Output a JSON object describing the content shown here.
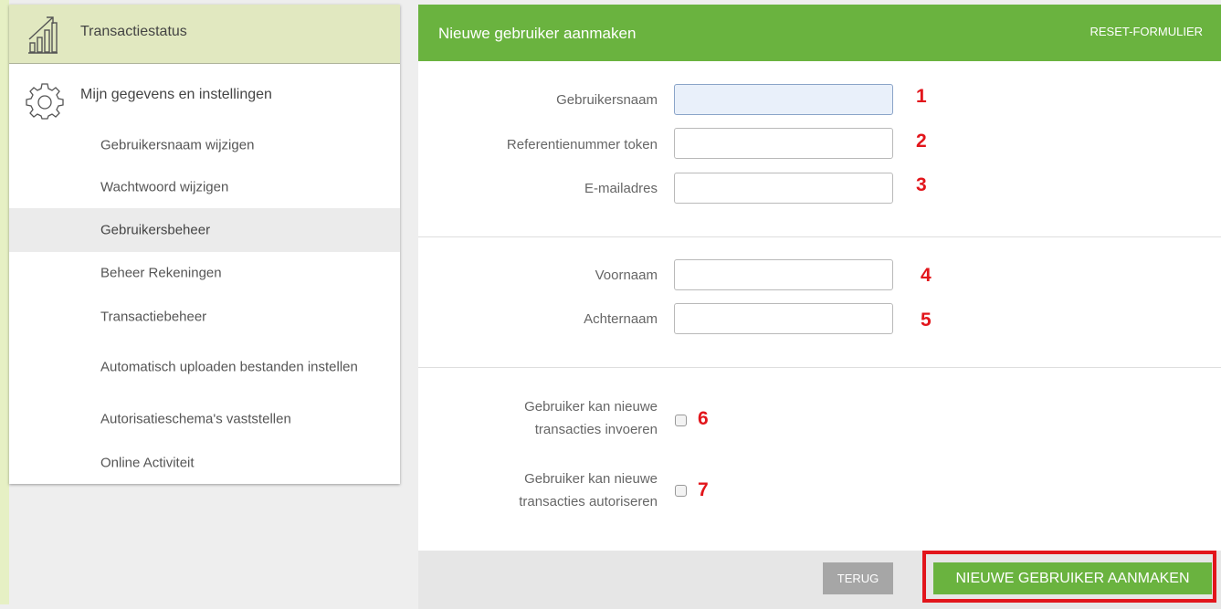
{
  "sidebar": {
    "header_label": "Transactiestatus",
    "section_label": "Mijn gegevens en instellingen",
    "items": [
      {
        "label": "Gebruikersnaam wijzigen"
      },
      {
        "label": "Wachtwoord wijzigen"
      },
      {
        "label": "Gebruikersbeheer",
        "active": true
      },
      {
        "label": "Beheer Rekeningen"
      },
      {
        "label": "Transactiebeheer"
      },
      {
        "label": "Automatisch uploaden bestanden instellen"
      },
      {
        "label": "Autorisatieschema's vaststellen"
      },
      {
        "label": "Online Activiteit"
      }
    ]
  },
  "form": {
    "title": "Nieuwe gebruiker aanmaken",
    "reset_label": "RESET-FORMULIER",
    "fields": [
      {
        "label": "Gebruikersnaam",
        "value": "",
        "marker": "1"
      },
      {
        "label": "Referentienummer token",
        "value": "",
        "marker": "2"
      },
      {
        "label": "E-mailadres",
        "value": "",
        "marker": "3"
      },
      {
        "label": "Voornaam",
        "value": "",
        "marker": "4"
      },
      {
        "label": "Achternaam",
        "value": "",
        "marker": "5"
      }
    ],
    "checkboxes": [
      {
        "label": "Gebruiker kan nieuwe transacties invoeren",
        "checked": false,
        "marker": "6"
      },
      {
        "label": "Gebruiker kan nieuwe transacties autoriseren",
        "checked": false,
        "marker": "7"
      }
    ],
    "back_label": "TERUG",
    "create_label": "NIEUWE GEBRUIKER AANMAKEN"
  },
  "colors": {
    "accent_green": "#6ab33f",
    "sidebar_header_bg": "#e1e8c0",
    "marker_red": "#e2151b"
  },
  "icons": {
    "header": "bar-chart-icon",
    "section": "gear-icon"
  }
}
